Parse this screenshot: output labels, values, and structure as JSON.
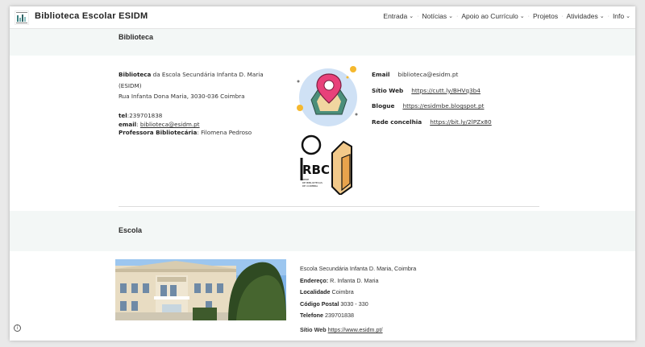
{
  "header": {
    "site_title": "Biblioteca Escolar ESIDM",
    "nav": [
      {
        "label": "Entrada",
        "dropdown": true
      },
      {
        "label": "Notícias",
        "dropdown": true
      },
      {
        "label": "Apoio ao Currículo",
        "dropdown": true
      },
      {
        "label": "Projetos",
        "dropdown": false
      },
      {
        "label": "Atividades",
        "dropdown": true
      },
      {
        "label": "Info",
        "dropdown": true
      }
    ]
  },
  "biblioteca": {
    "title": "Biblioteca",
    "intro_bold": "Biblioteca",
    "intro_rest": " da Escola Secundária Infanta D. Maria (ESIDM)",
    "address": "Rua Infanta Dona Maria, 3030-036 Coimbra",
    "tel_label": "tel",
    "tel_value": ":239701838",
    "email_label": "email",
    "email_sep": ": ",
    "email_value": "biblioteca@esidm.pt",
    "prof_label": "Professora Bibliotecária",
    "prof_value": ": Filomena Pedroso",
    "rbc_logo_text": "RBC",
    "rbc_logo_sub": "REDE DE BIBLIOTECAS DE COIMBRA"
  },
  "contacts": [
    {
      "label": "Email",
      "value": "biblioteca@esidm.pt",
      "link": false
    },
    {
      "label": "Sítio Web",
      "value": "https://cutt.ly/BHVq3b4",
      "link": true
    },
    {
      "label": "Blogue",
      "value": "https://esidmbe.blogspot.pt",
      "link": true
    },
    {
      "label": "Rede concelhia",
      "value": "https://bit.ly/2lPZx80",
      "link": true
    }
  ],
  "escola": {
    "title": "Escola",
    "name": "Escola Secundária Infanta D. Maria, Coimbra",
    "endereco_label": "Endereço:",
    "endereco_value": " R. Infanta D. Maria",
    "localidade_label": "Localidade",
    "localidade_value": " Coimbra",
    "postal_label": "Código Postal",
    "postal_value": " 3030 - 330",
    "telefone_label": "Telefone",
    "telefone_value": " 239701838",
    "site_label": "Sítio Web",
    "site_value": "https://www.esidm.pt/"
  },
  "colors": {
    "band": "#f3f7f6",
    "pin": "#e8417a",
    "map_circle": "#cfe1f5",
    "accent_yellow": "#f5b82e"
  },
  "icons": {
    "logo": "bar-chart-logo-icon",
    "info": "info-icon",
    "chevron": "chevron-down-icon"
  }
}
